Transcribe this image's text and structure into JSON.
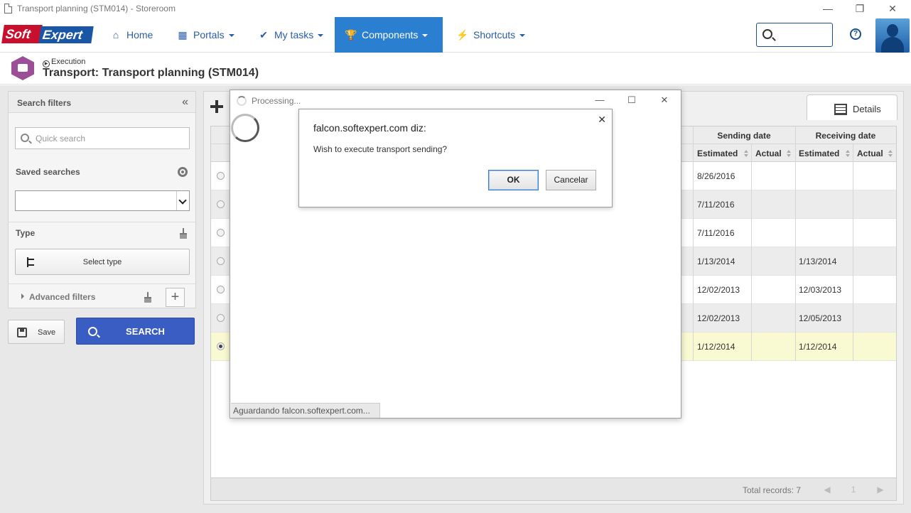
{
  "window": {
    "title": "Transport planning (STM014) - Storeroom"
  },
  "nav": {
    "logo_soft": "Soft",
    "logo_expert": "Expert",
    "items": [
      {
        "label": "Home",
        "icon": "home-icon",
        "has_caret": false
      },
      {
        "label": "Portals",
        "icon": "grid-icon",
        "has_caret": true
      },
      {
        "label": "My tasks",
        "icon": "checkmark-icon",
        "has_caret": true
      },
      {
        "label": "Components",
        "icon": "trophy-icon",
        "has_caret": true,
        "active": true
      },
      {
        "label": "Shortcuts",
        "icon": "lightning-icon",
        "has_caret": true
      }
    ],
    "help_glyph": "?"
  },
  "page": {
    "breadcrumb": "Execution",
    "title": "Transport: Transport planning (STM014)"
  },
  "filters": {
    "header": "Search filters",
    "quick_search_placeholder": "Quick search",
    "saved_searches_label": "Saved searches",
    "type_label": "Type",
    "select_type_label": "Select type",
    "advanced_filters_label": "Advanced filters",
    "save_label": "Save",
    "search_label": "SEARCH"
  },
  "grid": {
    "details_tab": "Details",
    "group_headers": [
      "Sending date",
      "Receiving date"
    ],
    "columns": [
      "Estimated",
      "Actual",
      "Estimated",
      "Actual"
    ],
    "rows": [
      {
        "selected": false,
        "send_est": "8/26/2016",
        "send_act": "",
        "recv_est": "",
        "recv_act": ""
      },
      {
        "selected": false,
        "send_est": "7/11/2016",
        "send_act": "",
        "recv_est": "",
        "recv_act": ""
      },
      {
        "selected": false,
        "send_est": "7/11/2016",
        "send_act": "",
        "recv_est": "",
        "recv_act": ""
      },
      {
        "selected": false,
        "send_est": "1/13/2014",
        "send_act": "",
        "recv_est": "1/13/2014",
        "recv_act": ""
      },
      {
        "selected": false,
        "send_est": "12/02/2013",
        "send_act": "",
        "recv_est": "12/03/2013",
        "recv_act": ""
      },
      {
        "selected": false,
        "send_est": "12/02/2013",
        "send_act": "",
        "recv_est": "12/05/2013",
        "recv_act": ""
      },
      {
        "selected": true,
        "send_est": "1/12/2014",
        "send_act": "",
        "recv_est": "1/12/2014",
        "recv_act": ""
      }
    ],
    "total_records": "Total records: 7",
    "page_number": "1"
  },
  "processing": {
    "title": "Processing...",
    "status": "Aguardando falcon.softexpert.com..."
  },
  "alert": {
    "origin": "falcon.softexpert.com diz:",
    "message": "Wish to execute transport sending?",
    "ok_label": "OK",
    "cancel_label": "Cancelar"
  },
  "colors": {
    "nav_active": "#2a7fd1",
    "search_button": "#3a5dc4",
    "selected_row": "#fafad2",
    "module_icon": "#9b4f96"
  }
}
